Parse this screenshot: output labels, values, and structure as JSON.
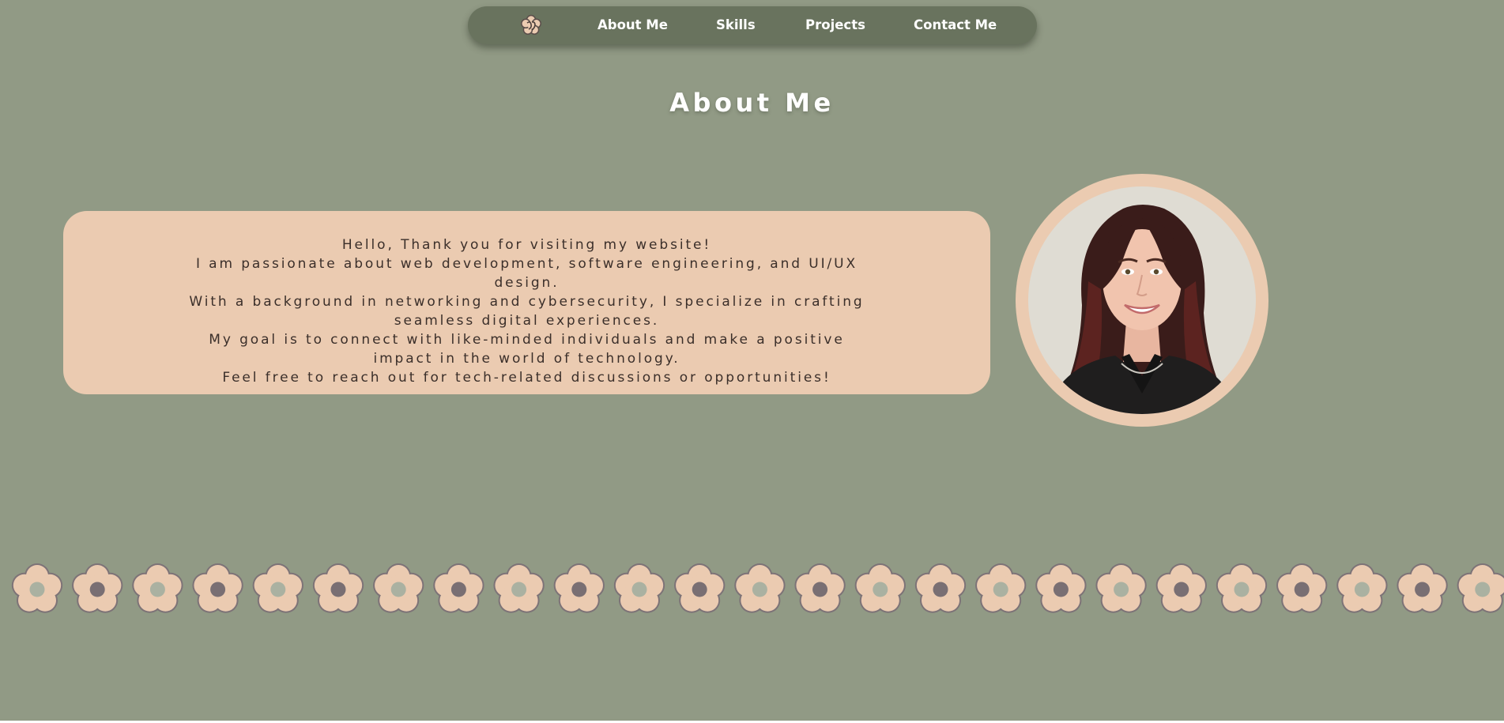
{
  "nav": {
    "logo_icon": "flower-logo-icon",
    "items": [
      {
        "label": "About Me"
      },
      {
        "label": "Skills"
      },
      {
        "label": "Projects"
      },
      {
        "label": "Contact Me"
      }
    ],
    "bar_color": "#69735e"
  },
  "about": {
    "title": "About Me",
    "lines": [
      "Hello, Thank you for visiting my website!",
      "I am passionate about web development, software engineering, and UI/UX design.",
      "With a background in networking and cybersecurity, I specialize in crafting seamless digital experiences.",
      "My goal is to connect with like-minded individuals and make a positive impact in the world of technology.",
      "Feel free to reach out for tech-related discussions or opportunities!"
    ]
  },
  "portrait": {
    "icon": "profile-photo"
  },
  "decor": {
    "flower_icon": "flower-icon",
    "flower_count": 25,
    "center_colors": [
      "#aab1a1",
      "#796f73"
    ]
  },
  "colors": {
    "background": "#919a85",
    "card": "#ebcbb1",
    "petal": "#ebcbb1",
    "petal_outline": "#7d7377",
    "text_dark": "#3b2f2a",
    "title": "#ffffff"
  }
}
